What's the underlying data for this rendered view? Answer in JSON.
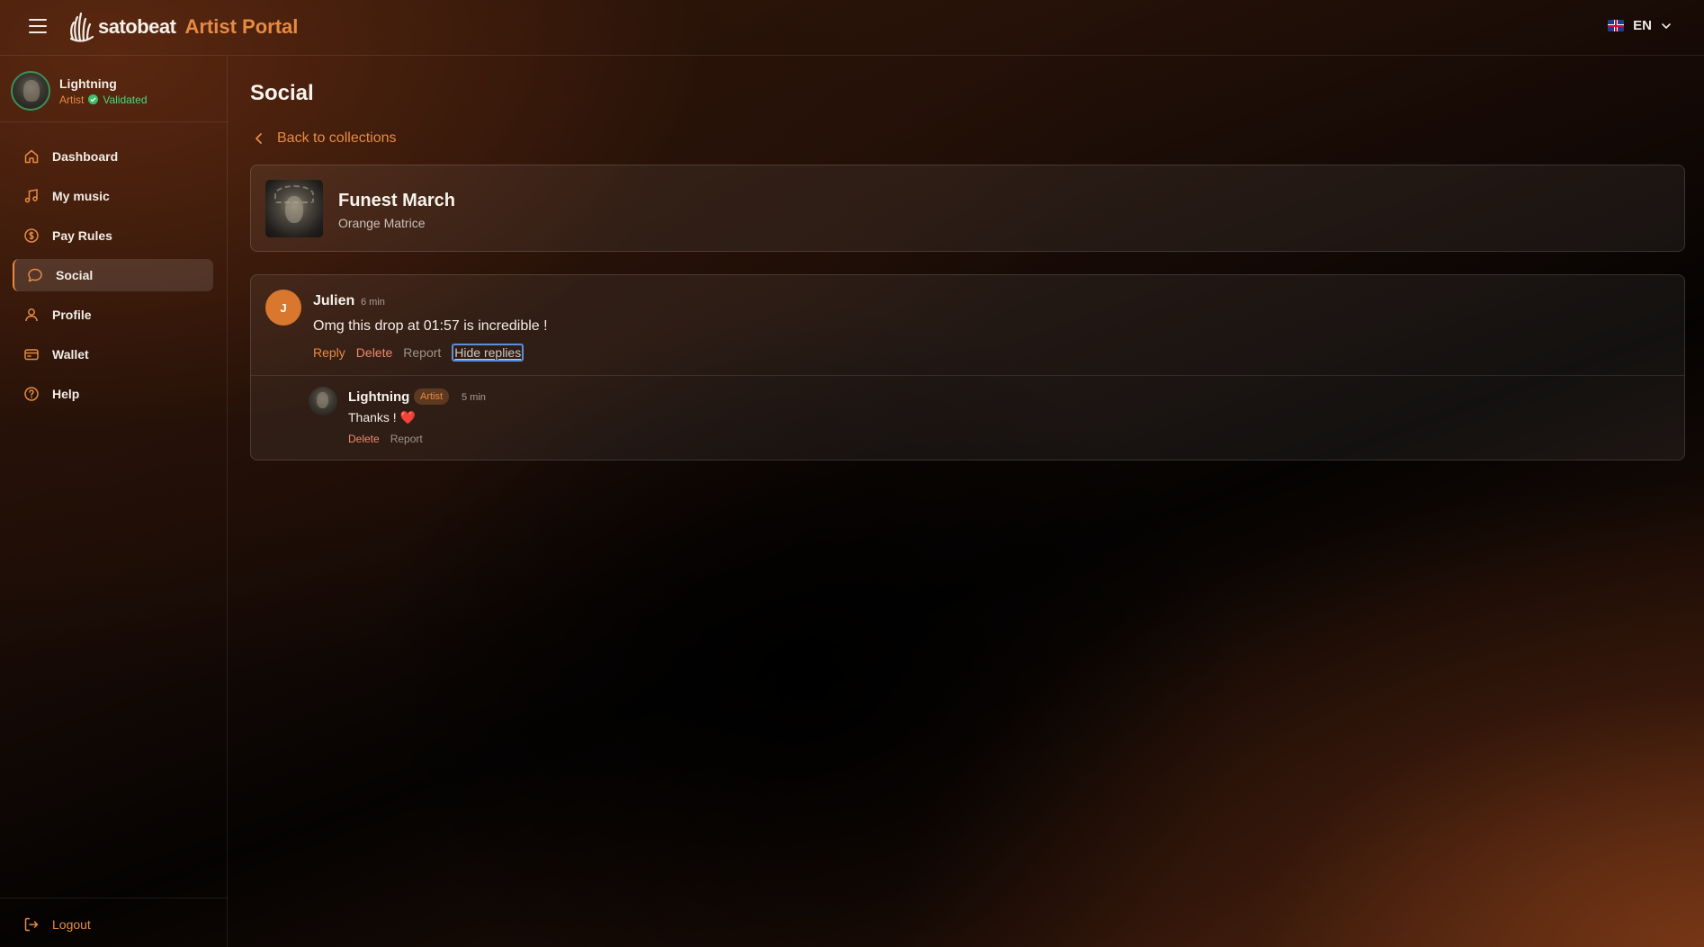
{
  "header": {
    "menu_icon": "hamburger-icon",
    "logo_text": "satobeat",
    "portal_title": "Artist Portal",
    "language": {
      "flag": "uk-flag-icon",
      "code": "EN"
    }
  },
  "user": {
    "name": "Lightning",
    "role": "Artist",
    "status": "Validated",
    "status_color": "#4fd47f"
  },
  "sidebar": {
    "items": [
      {
        "label": "Dashboard",
        "icon": "home-icon",
        "active": false
      },
      {
        "label": "My music",
        "icon": "music-note-icon",
        "active": false
      },
      {
        "label": "Pay Rules",
        "icon": "dollar-circle-icon",
        "active": false
      },
      {
        "label": "Social",
        "icon": "chat-bubble-icon",
        "active": true
      },
      {
        "label": "Profile",
        "icon": "user-icon",
        "active": false
      },
      {
        "label": "Wallet",
        "icon": "wallet-icon",
        "active": false
      },
      {
        "label": "Help",
        "icon": "help-circle-icon",
        "active": false
      }
    ],
    "logout_label": "Logout"
  },
  "main": {
    "title": "Social",
    "back_label": "Back to collections",
    "collection": {
      "title": "Funest March",
      "artist": "Orange Matrice"
    },
    "comment": {
      "avatar_initial": "J",
      "author": "Julien",
      "time": "6 min",
      "text": "Omg this drop at 01:57 is incredible !",
      "actions": {
        "reply": "Reply",
        "delete": "Delete",
        "report": "Report",
        "hide_replies": "Hide replies"
      }
    },
    "reply": {
      "author": "Lightning",
      "badge": "Artist",
      "time": "5 min",
      "text": "Thanks ! ❤️",
      "actions": {
        "delete": "Delete",
        "report": "Report"
      }
    }
  },
  "colors": {
    "accent": "#e68b43",
    "danger": "#ef8a6b",
    "focus_ring": "#5a8fdc"
  }
}
